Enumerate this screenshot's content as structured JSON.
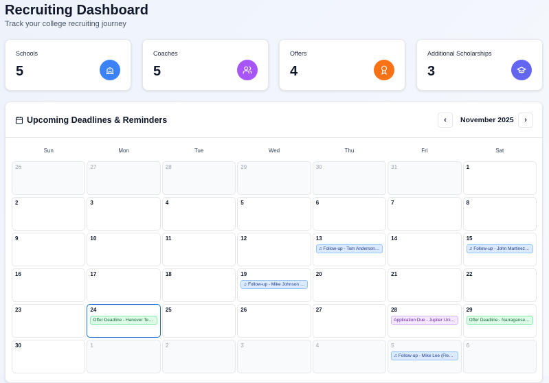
{
  "header": {
    "title": "Recruiting Dashboard",
    "subtitle": "Track your college recruiting journey"
  },
  "stats": [
    {
      "label": "Schools",
      "value": "5",
      "icon": "school-icon",
      "color": "#3b82f6"
    },
    {
      "label": "Coaches",
      "value": "5",
      "icon": "users-icon",
      "color": "#a855f7"
    },
    {
      "label": "Offers",
      "value": "4",
      "icon": "award-icon",
      "color": "#f97316"
    },
    {
      "label": "Additional Scholarships",
      "value": "3",
      "icon": "graduation-cap-icon",
      "color": "#6366f1"
    }
  ],
  "calendar": {
    "title": "Upcoming Deadlines & Reminders",
    "month": "November 2025",
    "prev": "‹",
    "next": "›",
    "weekdays": [
      "Sun",
      "Mon",
      "Tue",
      "Wed",
      "Thu",
      "Fri",
      "Sat"
    ],
    "days": [
      {
        "d": "26",
        "out": true
      },
      {
        "d": "27",
        "out": true
      },
      {
        "d": "28",
        "out": true
      },
      {
        "d": "29",
        "out": true
      },
      {
        "d": "30",
        "out": true
      },
      {
        "d": "31",
        "out": true
      },
      {
        "d": "1"
      },
      {
        "d": "2"
      },
      {
        "d": "3"
      },
      {
        "d": "4"
      },
      {
        "d": "5"
      },
      {
        "d": "6"
      },
      {
        "d": "7"
      },
      {
        "d": "8"
      },
      {
        "d": "9"
      },
      {
        "d": "10"
      },
      {
        "d": "11"
      },
      {
        "d": "12"
      },
      {
        "d": "13",
        "events": [
          {
            "type": "follow",
            "text": "♫ Follow-up - Tom Anderson (Ho..."
          }
        ]
      },
      {
        "d": "14"
      },
      {
        "d": "15",
        "events": [
          {
            "type": "follow",
            "text": "♫ Follow-up - John Martinez (Nar..."
          }
        ]
      },
      {
        "d": "16"
      },
      {
        "d": "17"
      },
      {
        "d": "18"
      },
      {
        "d": "19",
        "events": [
          {
            "type": "follow",
            "text": "♫ Follow-up - Mike Johnson (Jupi..."
          }
        ]
      },
      {
        "d": "20"
      },
      {
        "d": "21"
      },
      {
        "d": "22"
      },
      {
        "d": "23"
      },
      {
        "d": "24",
        "today": true,
        "events": [
          {
            "type": "offer",
            "text": "Offer Deadline - Hanover Tech Un..."
          }
        ]
      },
      {
        "d": "25"
      },
      {
        "d": "26"
      },
      {
        "d": "27"
      },
      {
        "d": "28",
        "events": [
          {
            "type": "app",
            "text": "Application Due - Jupiter University"
          }
        ]
      },
      {
        "d": "29",
        "events": [
          {
            "type": "offer",
            "text": "Offer Deadline - Narragansett Un..."
          }
        ]
      },
      {
        "d": "30"
      },
      {
        "d": "1",
        "out": true
      },
      {
        "d": "2",
        "out": true
      },
      {
        "d": "3",
        "out": true
      },
      {
        "d": "4",
        "out": true
      },
      {
        "d": "5",
        "out": true,
        "events": [
          {
            "type": "follow",
            "text": "♫ Follow-up - Mike Lee (Flemingt..."
          }
        ]
      },
      {
        "d": "6",
        "out": true
      }
    ]
  }
}
